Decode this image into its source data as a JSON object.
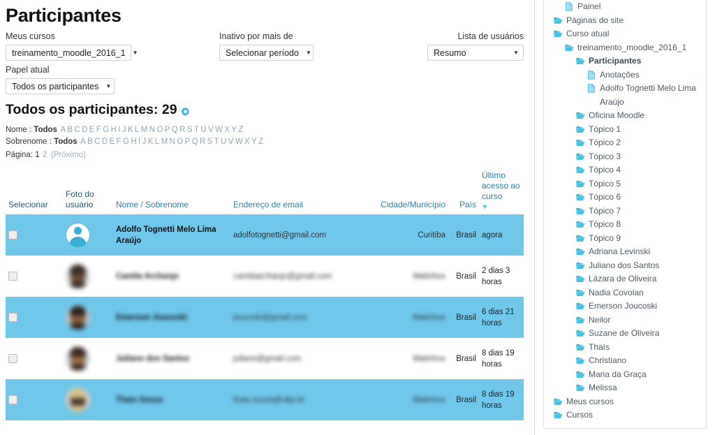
{
  "page": {
    "title": "Participantes"
  },
  "filters": {
    "courses": {
      "label": "Meus cursos",
      "value": "treinamento_moodle_2016_1"
    },
    "role": {
      "label": "Papel atual",
      "value": "Todos os participantes"
    },
    "inactive": {
      "label": "Inativo por mais de",
      "value": "Selecionar período"
    },
    "userlist": {
      "label": "Lista de usuários",
      "value": "Resumo"
    },
    "caret": "▼"
  },
  "summary": {
    "heading": "Todos os participantes: 29",
    "gear_icon": "gear-icon",
    "gear_color": "#3ab5d9"
  },
  "initials": {
    "firstname_label": "Nome :",
    "lastname_label": "Sobrenome :",
    "all": "Todos",
    "letters": [
      "A",
      "B",
      "C",
      "D",
      "E",
      "F",
      "G",
      "H",
      "I",
      "J",
      "K",
      "L",
      "M",
      "N",
      "O",
      "P",
      "Q",
      "R",
      "S",
      "T",
      "U",
      "V",
      "W",
      "X",
      "Y",
      "Z"
    ],
    "page_label": "Página:",
    "pages": [
      "1",
      "2"
    ],
    "next": "(Próximo)"
  },
  "table": {
    "columns": {
      "select": "Selecionar",
      "photo": "Foto do usuário",
      "name": "Nome",
      "name_sep": "/",
      "surname": "Sobrenome",
      "email": "Endereço de email",
      "city": "Cidade/Município",
      "country": "País",
      "lastaccess": "Último acesso ao curso",
      "sort_caret": "▼"
    },
    "rows": [
      {
        "selected": false,
        "avatar": "default-user-icon",
        "name": "Adolfo Tognetti Melo Lima Araújo",
        "email": "adolfotognetti@gmail.com",
        "city": "Curitiba",
        "country": "Brasil",
        "lastaccess": "agora",
        "highlight": true,
        "redacted": false
      },
      {
        "selected": false,
        "avatar": "user-photo",
        "name": "Camila Archanjo",
        "email": "camilaarchanjo@gmail.com",
        "city": "Matinhos",
        "country": "Brasil",
        "lastaccess": "2 dias 3 horas",
        "highlight": false,
        "redacted": true
      },
      {
        "selected": false,
        "avatar": "user-photo",
        "name": "Emerson Joucoski",
        "email": "joucoski@gmail.com",
        "city": "Matinhos",
        "country": "Brasil",
        "lastaccess": "6 dias 21 horas",
        "highlight": true,
        "redacted": true
      },
      {
        "selected": false,
        "avatar": "user-photo",
        "name": "Juliano dos Santos",
        "email": "juliano@gmail.com",
        "city": "Matinhos",
        "country": "Brasil",
        "lastaccess": "8 dias 19 horas",
        "highlight": false,
        "redacted": true
      },
      {
        "selected": false,
        "avatar": "user-photo",
        "name": "Thais Souza",
        "email": "thais.souza@ufpr.br",
        "city": "Matinhos",
        "country": "Brasil",
        "lastaccess": "8 dias 19 horas",
        "highlight": true,
        "redacted": true
      }
    ]
  },
  "sidebar": {
    "items": [
      {
        "label": "Painel",
        "icon": "page-icon",
        "depth": 2,
        "current": false
      },
      {
        "label": "Páginas do site",
        "icon": "folder-icon",
        "depth": 1,
        "current": false
      },
      {
        "label": "Curso atual",
        "icon": "folder-icon",
        "depth": 1,
        "current": false
      },
      {
        "label": "treinamento_moodle_2016_1",
        "icon": "folder-icon",
        "depth": 2,
        "current": false
      },
      {
        "label": "Participantes",
        "icon": "folder-icon",
        "depth": 3,
        "current": true
      },
      {
        "label": "Anotações",
        "icon": "page-icon",
        "depth": 4,
        "current": false
      },
      {
        "label": "Adolfo Tognetti Melo Lima Araújo",
        "icon": "page-icon",
        "depth": 4,
        "current": false
      },
      {
        "label": "Oficina Moodle",
        "icon": "folder-icon",
        "depth": 3,
        "current": false
      },
      {
        "label": "Tópico 1",
        "icon": "folder-icon",
        "depth": 3,
        "current": false
      },
      {
        "label": "Tópico 2",
        "icon": "folder-icon",
        "depth": 3,
        "current": false
      },
      {
        "label": "Tópico 3",
        "icon": "folder-icon",
        "depth": 3,
        "current": false
      },
      {
        "label": "Tópico 4",
        "icon": "folder-icon",
        "depth": 3,
        "current": false
      },
      {
        "label": "Tópico 5",
        "icon": "folder-icon",
        "depth": 3,
        "current": false
      },
      {
        "label": "Tópico 6",
        "icon": "folder-icon",
        "depth": 3,
        "current": false
      },
      {
        "label": "Tópico 7",
        "icon": "folder-icon",
        "depth": 3,
        "current": false
      },
      {
        "label": "Tópico 8",
        "icon": "folder-icon",
        "depth": 3,
        "current": false
      },
      {
        "label": "Tópico 9",
        "icon": "folder-icon",
        "depth": 3,
        "current": false
      },
      {
        "label": "Adriana Levinski",
        "icon": "folder-icon",
        "depth": 3,
        "current": false
      },
      {
        "label": "Juliano dos Santos",
        "icon": "folder-icon",
        "depth": 3,
        "current": false
      },
      {
        "label": "Lázara de Oliveira",
        "icon": "folder-icon",
        "depth": 3,
        "current": false
      },
      {
        "label": "Nadia Covolan",
        "icon": "folder-icon",
        "depth": 3,
        "current": false
      },
      {
        "label": "Emerson Joucoski",
        "icon": "folder-icon",
        "depth": 3,
        "current": false
      },
      {
        "label": "Neilor",
        "icon": "folder-icon",
        "depth": 3,
        "current": false
      },
      {
        "label": "Suzane de Oliveira",
        "icon": "folder-icon",
        "depth": 3,
        "current": false
      },
      {
        "label": "Thaís",
        "icon": "folder-icon",
        "depth": 3,
        "current": false
      },
      {
        "label": "Christiano",
        "icon": "folder-icon",
        "depth": 3,
        "current": false
      },
      {
        "label": "Maria da Graça",
        "icon": "folder-icon",
        "depth": 3,
        "current": false
      },
      {
        "label": "Melissa",
        "icon": "folder-icon",
        "depth": 3,
        "current": false
      },
      {
        "label": "Meus cursos",
        "icon": "folder-icon",
        "depth": 1,
        "current": false
      },
      {
        "label": "Cursos",
        "icon": "folder-icon",
        "depth": 1,
        "current": false
      }
    ]
  },
  "colors": {
    "highlight_row": "#6fc7ea",
    "link": "#2b7ea8",
    "tree_icon": "#3ab5d9",
    "accent": "#3ab5d9"
  }
}
